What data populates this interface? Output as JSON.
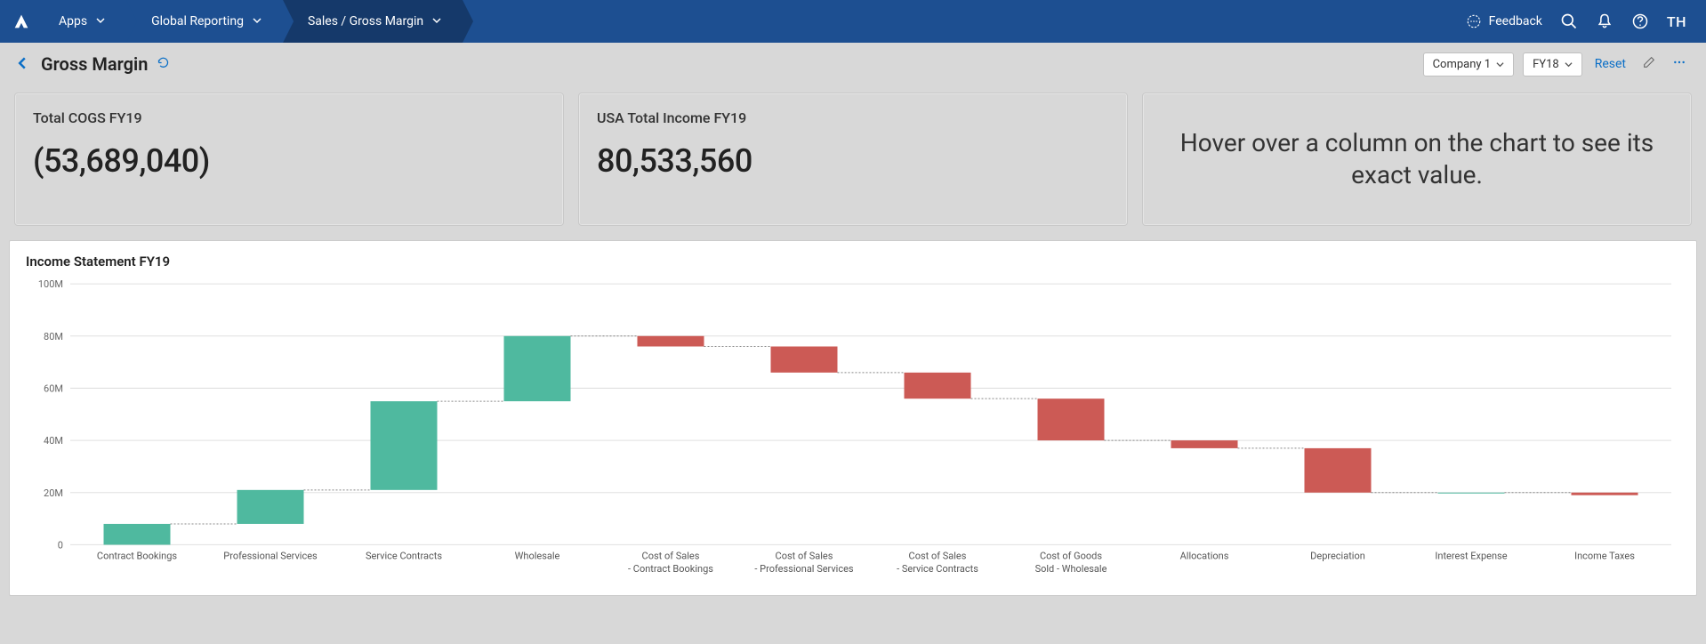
{
  "nav": {
    "apps": "Apps",
    "global_reporting": "Global Reporting",
    "sales_gross_margin": "Sales / Gross Margin"
  },
  "top_right": {
    "feedback": "Feedback",
    "user_initials": "TH"
  },
  "page": {
    "title": "Gross Margin"
  },
  "filters": {
    "company": "Company 1",
    "fiscal_year": "FY18",
    "reset": "Reset"
  },
  "kpis": {
    "cogs_title": "Total COGS FY19",
    "cogs_value": "(53,689,040)",
    "income_title": "USA Total Income FY19",
    "income_value": "80,533,560",
    "hint": "Hover over a column on the chart to see its exact value."
  },
  "chart": {
    "title": "Income Statement FY19"
  },
  "chart_data": {
    "type": "waterfall",
    "title": "Income Statement FY19",
    "ylabel": "",
    "ylim": [
      0,
      100
    ],
    "y_unit": "M",
    "y_ticks": [
      0,
      20,
      40,
      60,
      80,
      100
    ],
    "categories": [
      "Contract Bookings",
      "Professional Services",
      "Service Contracts",
      "Wholesale",
      "Cost of Sales - Contract Bookings",
      "Cost of Sales - Professional Services",
      "Cost of Sales - Service Contracts",
      "Cost of Goods Sold - Wholesale",
      "Allocations",
      "Depreciation",
      "Interest Expense",
      "Income Taxes"
    ],
    "values": [
      8,
      13,
      34,
      25,
      -4,
      -10,
      -10,
      -16,
      -3,
      -17,
      0,
      -1
    ],
    "colors": {
      "positive": "#4fb99f",
      "negative": "#cc5a55"
    }
  }
}
